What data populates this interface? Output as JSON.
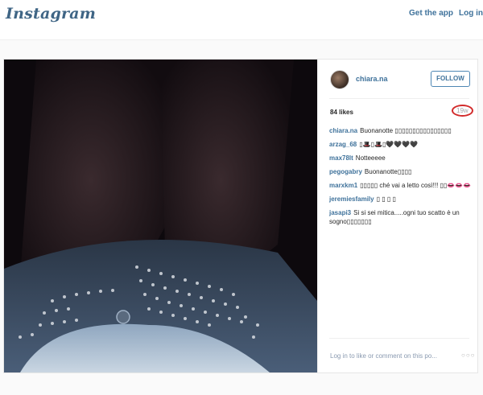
{
  "header": {
    "logo": "Instagram",
    "get_app": "Get the app",
    "login": "Log in"
  },
  "post": {
    "username": "chiara.na",
    "follow_label": "FOLLOW",
    "likes": "84 likes",
    "time": "19w",
    "comments": [
      {
        "user": "chiara.na",
        "text": "Buonanotte ▯▯▯▯▯▯▯▯▯▯▯▯▯▯▯▯"
      },
      {
        "user": "arzag_68",
        "text": "▯🎩▯🎩▯🖤🖤🖤🖤"
      },
      {
        "user": "max78lt",
        "text": "Notteeeee"
      },
      {
        "user": "pegogabry",
        "text": "Buonanotte▯▯▯▯"
      },
      {
        "user": "marxkm1",
        "text": "▯▯▯▯▯ ché vai a letto così!!! ▯▯👄👄👄"
      },
      {
        "user": "jeremiesfamily",
        "text": "▯ ▯ ▯ ▯"
      },
      {
        "user": "jasapi3",
        "text": "Si si sei mitica.....ogni tuo scatto è un sogno▯▯▯▯▯▯▯"
      }
    ],
    "login_prompt": "Log in to like or comment on this po...",
    "more_label": "○○○"
  }
}
